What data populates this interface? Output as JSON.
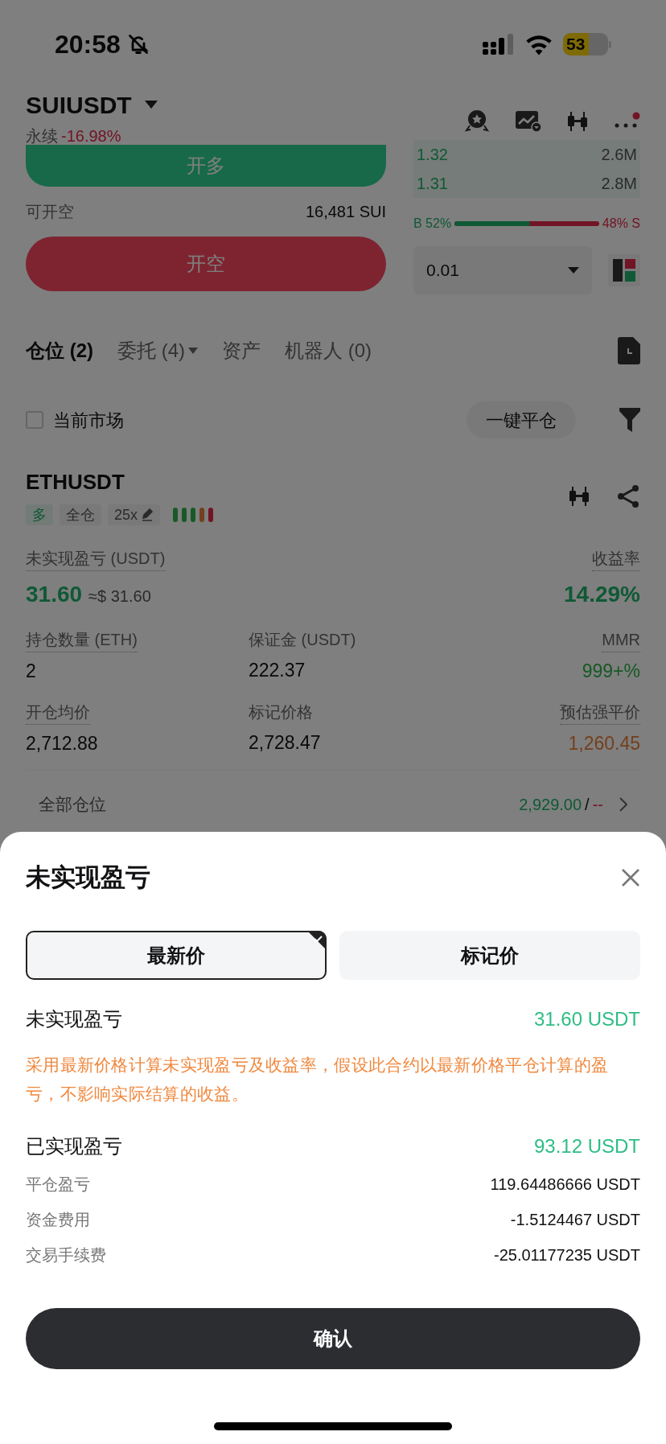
{
  "status_bar": {
    "time": "20:58",
    "battery": "53"
  },
  "header": {
    "symbol": "SUIUSDT",
    "contract_type": "永续",
    "change": "-16.98%"
  },
  "order_panel": {
    "long_button": "开多",
    "short_available_label": "可开空",
    "short_available_value": "16,481 SUI",
    "short_button": "开空"
  },
  "order_book": {
    "rows": [
      {
        "price": "1.32",
        "size": "2.6M"
      },
      {
        "price": "1.31",
        "size": "2.8M"
      }
    ],
    "ratio": {
      "buy_label": "B 52%",
      "sell_label": "48% S",
      "level": 0.52
    },
    "depth_select": "0.01"
  },
  "tabs": [
    {
      "label": "仓位 (2)",
      "selected": true,
      "dropdown": false
    },
    {
      "label": "委托 (4)",
      "selected": false,
      "dropdown": true
    },
    {
      "label": "资产",
      "selected": false,
      "dropdown": false
    },
    {
      "label": "机器人 (0)",
      "selected": false,
      "dropdown": false
    }
  ],
  "filter": {
    "label": "当前市场",
    "checked": false
  },
  "close_all_button": "一键平仓",
  "position": {
    "symbol": "ETHUSDT",
    "tags": [
      {
        "text": "多",
        "kind": "side"
      },
      {
        "text": "全仓",
        "kind": "mode"
      },
      {
        "text": "25x",
        "kind": "leverage"
      }
    ],
    "pnl": {
      "label": "未实现盈亏 (USDT)",
      "value": "31.60",
      "approx": "≈$ 31.60"
    },
    "roi": {
      "label": "收益率",
      "value": "14.29%"
    },
    "metrics": [
      {
        "label": "持仓数量 (ETH)",
        "value": "2",
        "kind": "plain"
      },
      {
        "label": "保证金 (USDT)",
        "value": "222.37",
        "kind": "plain"
      },
      {
        "label": "MMR",
        "value": "999+%",
        "kind": "good"
      },
      {
        "label": "开仓均价",
        "value": "2,712.88",
        "kind": "plain"
      },
      {
        "label": "标记价格",
        "value": "2,728.47",
        "kind": "plain"
      },
      {
        "label": "预估强平价",
        "value": "1,260.45",
        "kind": "warning"
      }
    ]
  },
  "summary": {
    "label": "全部仓位",
    "value": "2,929.00",
    "separator": "/",
    "value_2": "--"
  },
  "sheet": {
    "title": "未实现盈亏",
    "options": [
      {
        "label": "最新价",
        "selected": true
      },
      {
        "label": "标记价",
        "selected": false
      }
    ],
    "unrealized": {
      "label": "未实现盈亏",
      "value": "31.60 USDT"
    },
    "note": "采用最新价格计算未实现盈亏及收益率，假设此合约以最新价格平仓计算的盈亏，不影响实际结算的收益。",
    "realized": {
      "label": "已实现盈亏",
      "value": "93.12 USDT"
    },
    "details": [
      {
        "label": "平仓盈亏",
        "value": "119.64486666 USDT"
      },
      {
        "label": "资金费用",
        "value": "-1.5124467 USDT"
      },
      {
        "label": "交易手续费",
        "value": "-25.01177235 USDT"
      }
    ],
    "confirm_button": "确认"
  }
}
